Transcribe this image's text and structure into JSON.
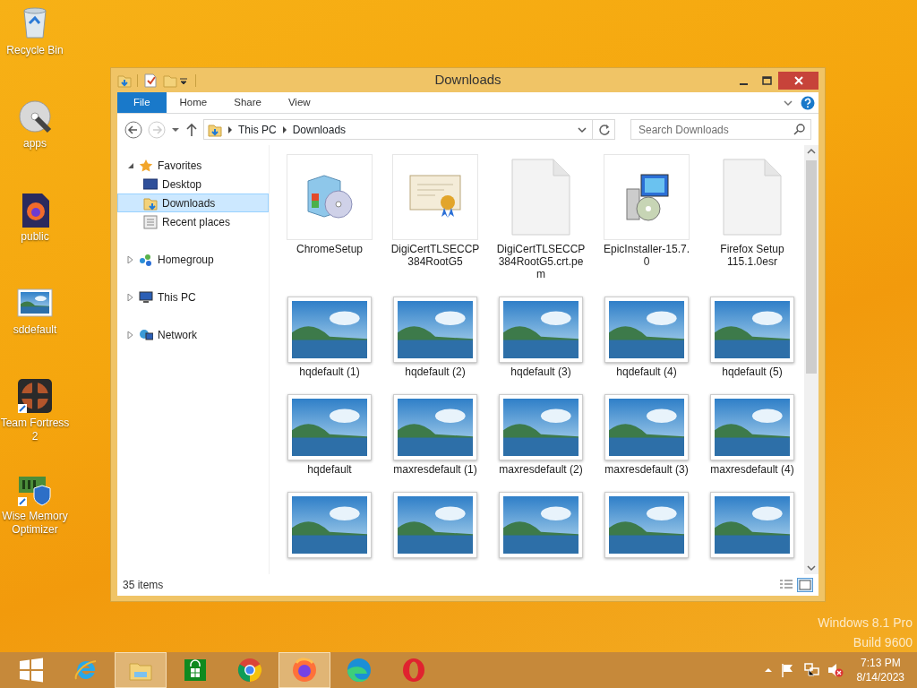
{
  "desktop_icons": [
    {
      "label": "Recycle Bin",
      "kind": "recycle"
    },
    {
      "label": "apps",
      "kind": "disc"
    },
    {
      "label": "public",
      "kind": "firefox-file"
    },
    {
      "label": "sddefault",
      "kind": "image"
    },
    {
      "label": "Team Fortress 2",
      "kind": "game"
    },
    {
      "label": "Wise Memory Optimizer",
      "kind": "memory"
    }
  ],
  "window": {
    "title": "Downloads",
    "ribbon_tabs": [
      {
        "label": "File",
        "selected": true
      },
      {
        "label": "Home",
        "selected": false
      },
      {
        "label": "Share",
        "selected": false
      },
      {
        "label": "View",
        "selected": false
      }
    ],
    "breadcrumb": [
      "This PC",
      "Downloads"
    ],
    "search": {
      "placeholder": "Search Downloads"
    },
    "nav_tree": [
      {
        "label": "Favorites",
        "kind": "star",
        "expanded": true,
        "selected": false,
        "children": [
          {
            "label": "Desktop",
            "kind": "desktop",
            "selected": false
          },
          {
            "label": "Downloads",
            "kind": "downloads",
            "selected": true
          },
          {
            "label": "Recent places",
            "kind": "recent",
            "selected": false
          }
        ]
      },
      {
        "label": "Homegroup",
        "kind": "homegroup",
        "expanded": false,
        "selected": false
      },
      {
        "label": "This PC",
        "kind": "pc",
        "expanded": false,
        "selected": false
      },
      {
        "label": "Network",
        "kind": "network",
        "expanded": false,
        "selected": false
      }
    ],
    "files": [
      {
        "name": "ChromeSetup",
        "kind": "installer"
      },
      {
        "name": "DigiCertTLSECCP384RootG5",
        "kind": "certificate"
      },
      {
        "name": "DigiCertTLSECCP384RootG5.crt.pem",
        "kind": "blank"
      },
      {
        "name": "EpicInstaller-15.7.0",
        "kind": "setup"
      },
      {
        "name": "Firefox Setup 115.1.0esr",
        "kind": "blank"
      },
      {
        "name": "hqdefault (1)",
        "kind": "image"
      },
      {
        "name": "hqdefault (2)",
        "kind": "image"
      },
      {
        "name": "hqdefault (3)",
        "kind": "image"
      },
      {
        "name": "hqdefault (4)",
        "kind": "image"
      },
      {
        "name": "hqdefault (5)",
        "kind": "image"
      },
      {
        "name": "hqdefault",
        "kind": "image"
      },
      {
        "name": "maxresdefault (1)",
        "kind": "image"
      },
      {
        "name": "maxresdefault (2)",
        "kind": "image"
      },
      {
        "name": "maxresdefault (3)",
        "kind": "image"
      },
      {
        "name": "maxresdefault (4)",
        "kind": "image"
      },
      {
        "kind": "image"
      },
      {
        "kind": "image"
      },
      {
        "kind": "image"
      },
      {
        "kind": "image"
      },
      {
        "kind": "image"
      }
    ],
    "status": "35 items"
  },
  "watermark": [
    "Windows 8.1 Pro",
    "Build 9600"
  ],
  "taskbar": {
    "apps": [
      {
        "kind": "ie",
        "active": false
      },
      {
        "kind": "explorer",
        "active": true
      },
      {
        "kind": "store",
        "active": false
      },
      {
        "kind": "chrome",
        "active": false
      },
      {
        "kind": "firefox",
        "active": true
      },
      {
        "kind": "edge",
        "active": false
      },
      {
        "kind": "opera",
        "active": false
      }
    ],
    "time": "7:13 PM",
    "date": "8/14/2023"
  }
}
